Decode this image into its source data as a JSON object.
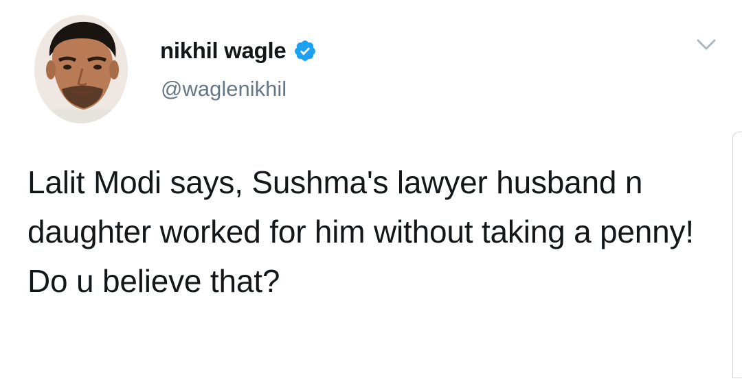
{
  "tweet": {
    "author": {
      "display_name": "nikhil wagle",
      "handle": "@waglenikhil",
      "verified": true
    },
    "text": "Lalit Modi says, Sushma's lawyer husband n daughter worked for him without taking a penny! Do u believe that?",
    "icons": {
      "verified": "verified-badge-icon",
      "menu": "chevron-down-icon"
    },
    "colors": {
      "verified_blue": "#1da1f2",
      "handle_gray": "#657786",
      "text": "#14171a"
    }
  }
}
